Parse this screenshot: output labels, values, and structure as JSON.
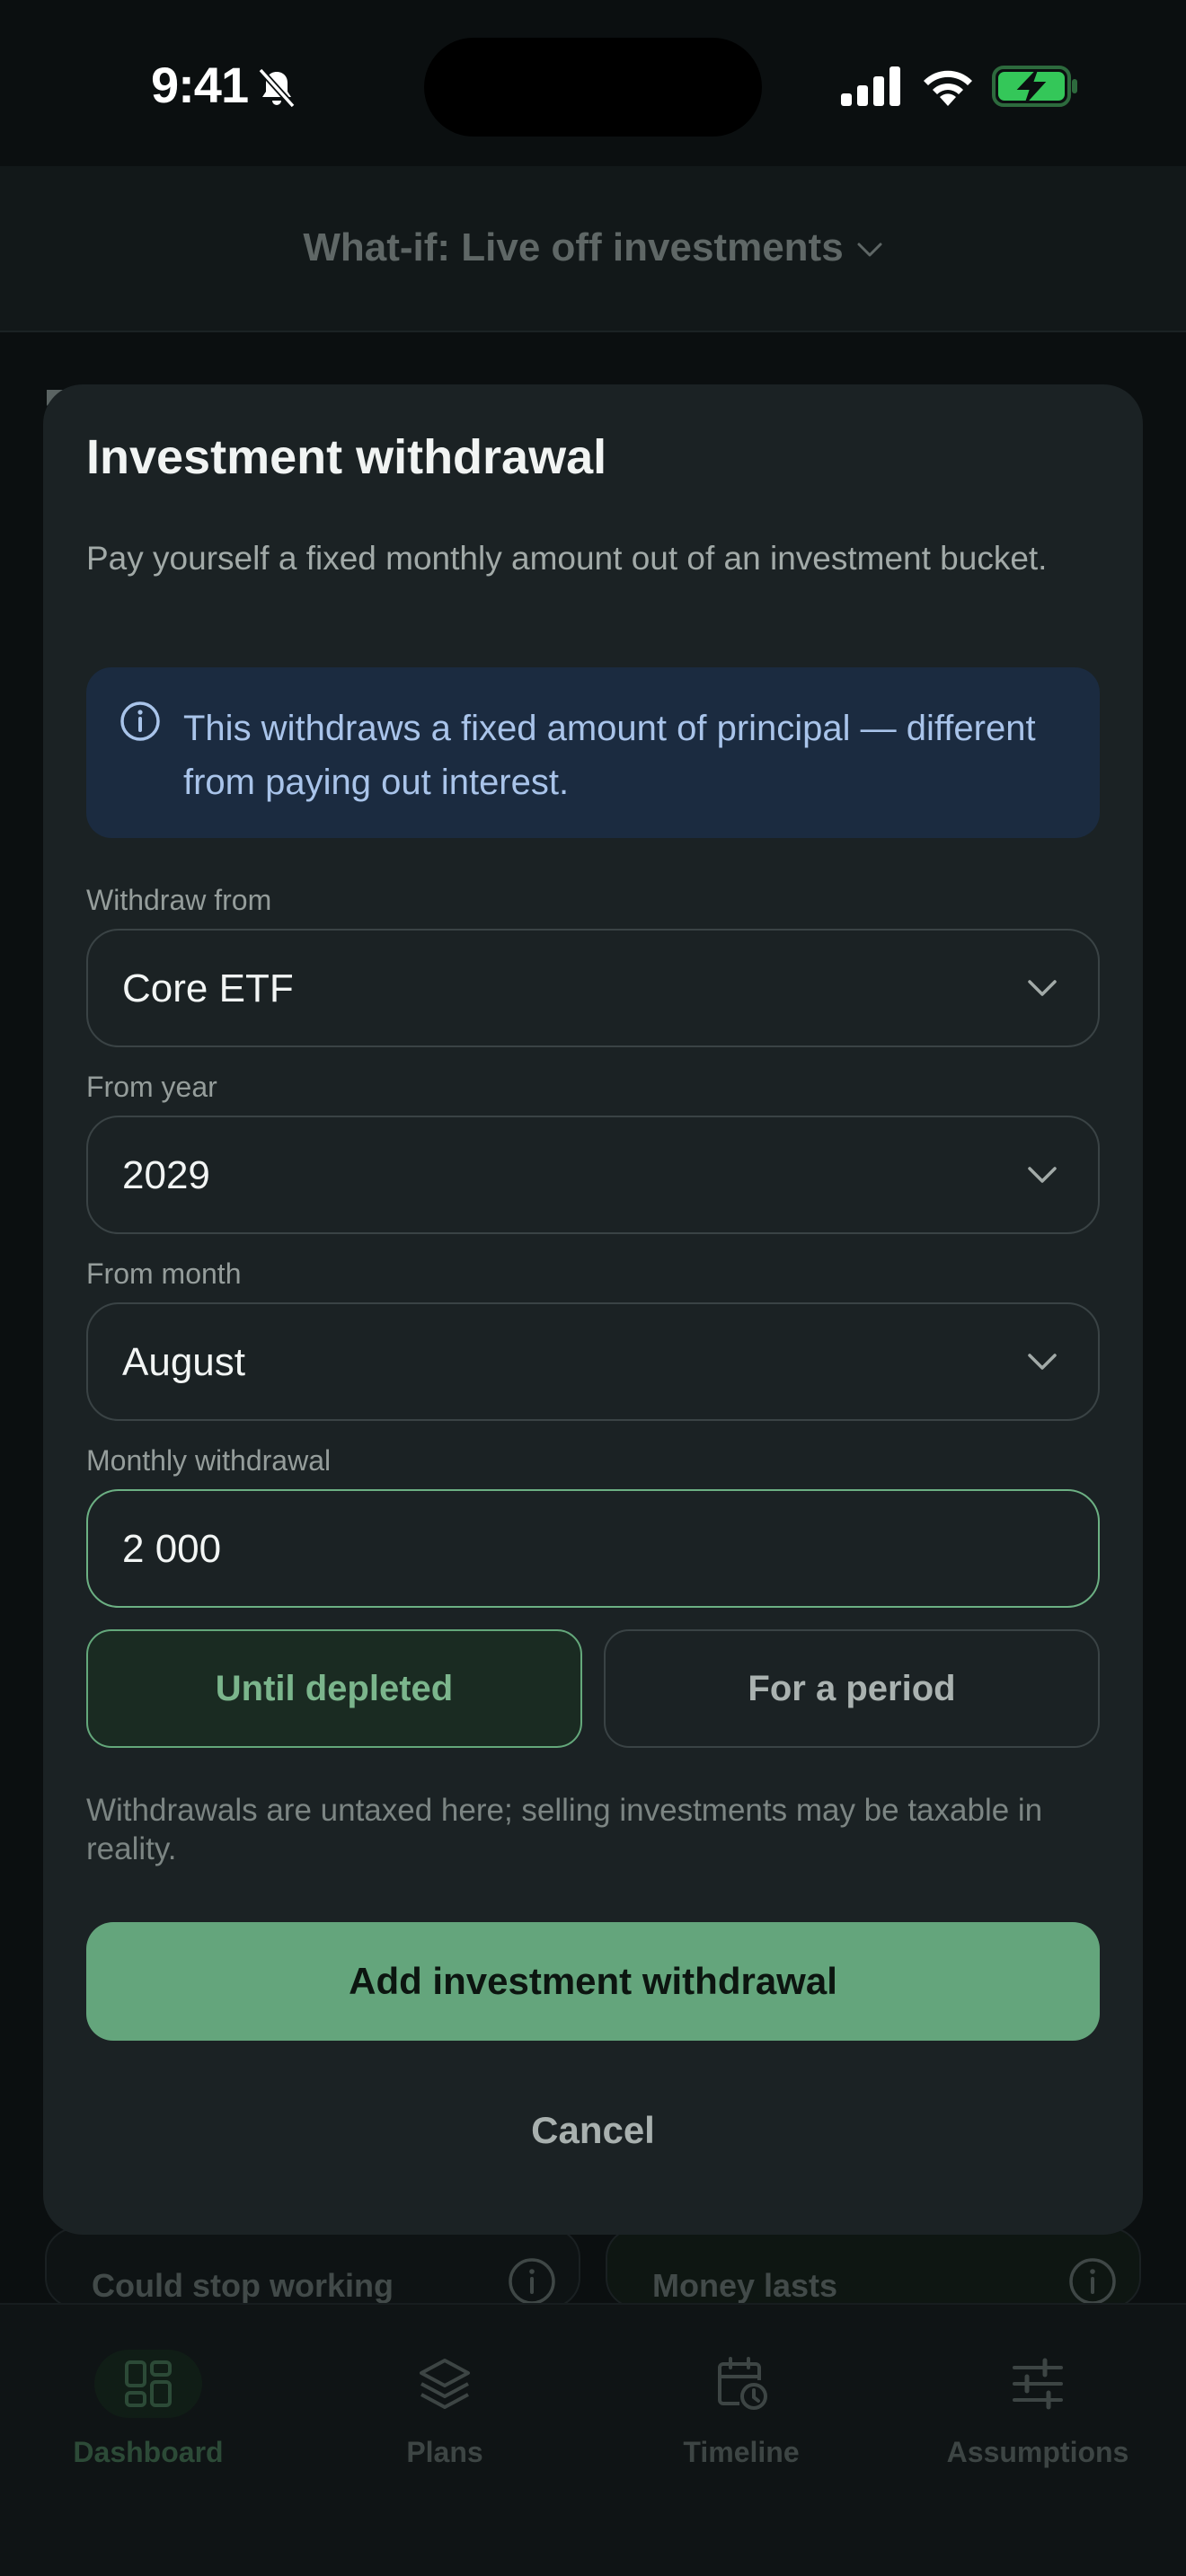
{
  "status_bar": {
    "time": "9:41"
  },
  "header": {
    "title": "What-if: Live off investments"
  },
  "modal": {
    "title": "Investment withdrawal",
    "description": "Pay yourself a fixed monthly amount out of an investment bucket.",
    "info": "This withdraws a fixed amount of principal — different from paying out interest.",
    "withdraw_from": {
      "label": "Withdraw from",
      "value": "Core ETF"
    },
    "from_year": {
      "label": "From year",
      "value": "2029"
    },
    "from_month": {
      "label": "From month",
      "value": "August"
    },
    "monthly_withdrawal": {
      "label": "Monthly withdrawal",
      "value": "2 000"
    },
    "duration": {
      "options": [
        "Until depleted",
        "For a period"
      ],
      "selected": "Until depleted"
    },
    "footnote": "Withdrawals are untaxed here; selling investments may be taxable in reality.",
    "primary_label": "Add investment withdrawal",
    "cancel_label": "Cancel"
  },
  "background_cards": [
    {
      "label": "Could stop working"
    },
    {
      "label": "Money lasts"
    }
  ],
  "tabbar": {
    "active": "Dashboard",
    "items": [
      {
        "label": "Dashboard",
        "icon": "dashboard-icon"
      },
      {
        "label": "Plans",
        "icon": "layers-icon"
      },
      {
        "label": "Timeline",
        "icon": "calendar-clock-icon"
      },
      {
        "label": "Assumptions",
        "icon": "sliders-icon"
      }
    ]
  },
  "colors": {
    "accent": "#64a57c",
    "background": "#0b0f10",
    "modal": "#1b2224",
    "info_bg": "#1b2b40",
    "info_text": "#a9c4ea"
  }
}
